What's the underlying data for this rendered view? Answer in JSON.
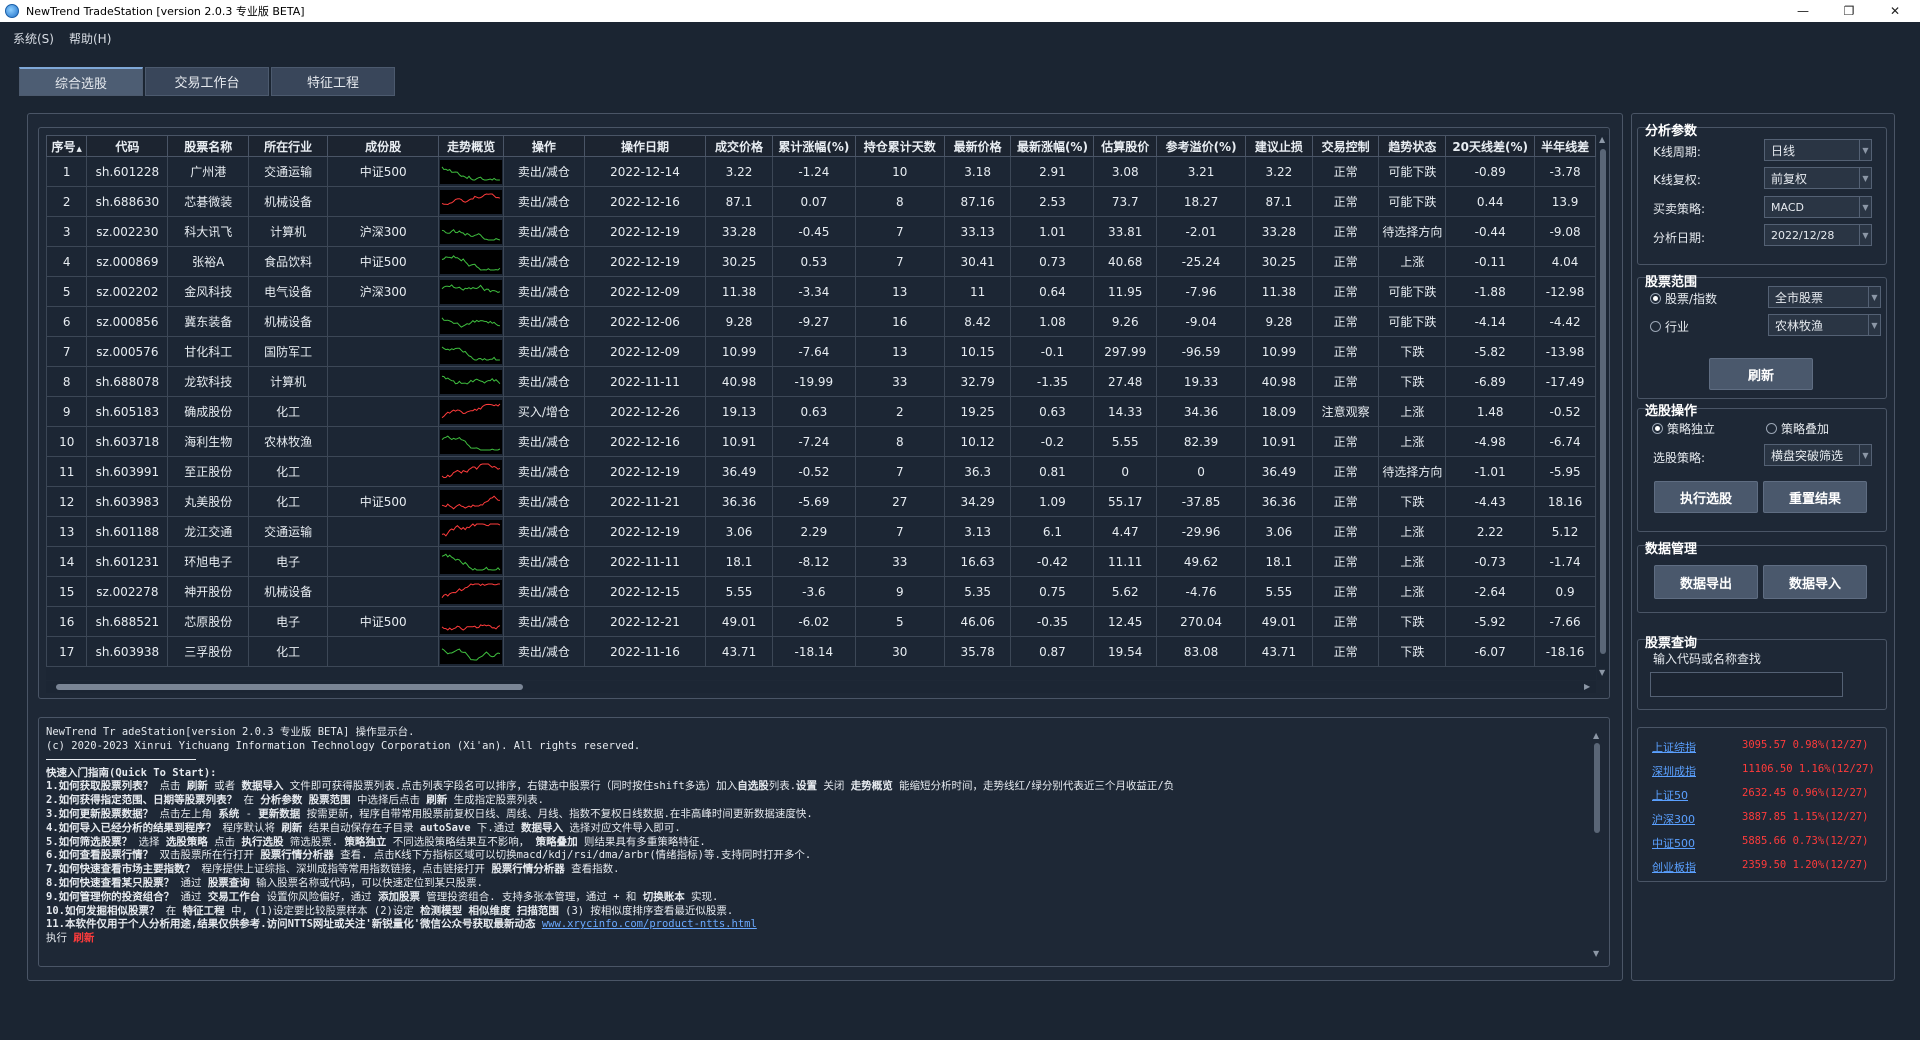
{
  "window": {
    "title": "NewTrend TradeStation [version 2.0.3 专业版 BETA]",
    "min_icon": "—",
    "max_icon": "❐",
    "close_icon": "✕"
  },
  "menu": [
    "系统(S)",
    "帮助(H)"
  ],
  "tabs": [
    {
      "label": "综合选股",
      "active": true
    },
    {
      "label": "交易工作台",
      "active": false
    },
    {
      "label": "特征工程",
      "active": false
    }
  ],
  "table": {
    "columns": [
      "序号",
      "代码",
      "股票名称",
      "所在行业",
      "成份股",
      "走势概览",
      "操作",
      "操作日期",
      "成交价格",
      "累计涨幅(%)",
      "持仓累计天数",
      "最新价格",
      "最新涨幅(%)",
      "估算股价",
      "参考溢价(%)",
      "建议止损",
      "交易控制",
      "趋势状态",
      "20天线差(%)",
      "半年线差"
    ],
    "rows": [
      {
        "n": "1",
        "code": "sh.601228",
        "name": "广州港",
        "ind": "交通运输",
        "comp": "中证500",
        "trend": "down",
        "op": "卖出/减仓",
        "date": "2022-12-14",
        "price": "3.22",
        "cum": "-1.24",
        "days": "10",
        "last": "3.18",
        "chg": "2.91",
        "est": "3.08",
        "prem": "3.21",
        "stop": "3.22",
        "ctrl": "正常",
        "state": "可能下跌",
        "d20": "-0.89",
        "half": "-3.78"
      },
      {
        "n": "2",
        "code": "sh.688630",
        "name": "芯碁微装",
        "ind": "机械设备",
        "comp": "",
        "trend": "up",
        "op": "卖出/减仓",
        "date": "2022-12-16",
        "price": "87.1",
        "cum": "0.07",
        "days": "8",
        "last": "87.16",
        "chg": "2.53",
        "est": "73.7",
        "prem": "18.27",
        "stop": "87.1",
        "ctrl": "正常",
        "state": "可能下跌",
        "d20": "0.44",
        "half": "13.9"
      },
      {
        "n": "3",
        "code": "sz.002230",
        "name": "科大讯飞",
        "ind": "计算机",
        "comp": "沪深300",
        "trend": "down",
        "op": "卖出/减仓",
        "date": "2022-12-19",
        "price": "33.28",
        "cum": "-0.45",
        "days": "7",
        "last": "33.13",
        "chg": "1.01",
        "est": "33.81",
        "prem": "-2.01",
        "stop": "33.28",
        "ctrl": "正常",
        "state": "待选择方向",
        "d20": "-0.44",
        "half": "-9.08"
      },
      {
        "n": "4",
        "code": "sz.000869",
        "name": "张裕A",
        "ind": "食品饮料",
        "comp": "中证500",
        "trend": "down",
        "op": "卖出/减仓",
        "date": "2022-12-19",
        "price": "30.25",
        "cum": "0.53",
        "days": "7",
        "last": "30.41",
        "chg": "0.73",
        "est": "40.68",
        "prem": "-25.24",
        "stop": "30.25",
        "ctrl": "正常",
        "state": "上涨",
        "d20": "-0.11",
        "half": "4.04"
      },
      {
        "n": "5",
        "code": "sz.002202",
        "name": "金风科技",
        "ind": "电气设备",
        "comp": "沪深300",
        "trend": "down",
        "op": "卖出/减仓",
        "date": "2022-12-09",
        "price": "11.38",
        "cum": "-3.34",
        "days": "13",
        "last": "11",
        "chg": "0.64",
        "est": "11.95",
        "prem": "-7.96",
        "stop": "11.38",
        "ctrl": "正常",
        "state": "可能下跌",
        "d20": "-1.88",
        "half": "-12.98"
      },
      {
        "n": "6",
        "code": "sz.000856",
        "name": "冀东装备",
        "ind": "机械设备",
        "comp": "",
        "trend": "down",
        "op": "卖出/减仓",
        "date": "2022-12-06",
        "price": "9.28",
        "cum": "-9.27",
        "days": "16",
        "last": "8.42",
        "chg": "1.08",
        "est": "9.26",
        "prem": "-9.04",
        "stop": "9.28",
        "ctrl": "正常",
        "state": "可能下跌",
        "d20": "-4.14",
        "half": "-4.42"
      },
      {
        "n": "7",
        "code": "sz.000576",
        "name": "甘化科工",
        "ind": "国防军工",
        "comp": "",
        "trend": "down",
        "op": "卖出/减仓",
        "date": "2022-12-09",
        "price": "10.99",
        "cum": "-7.64",
        "days": "13",
        "last": "10.15",
        "chg": "-0.1",
        "est": "297.99",
        "prem": "-96.59",
        "stop": "10.99",
        "ctrl": "正常",
        "state": "下跌",
        "d20": "-5.82",
        "half": "-13.98"
      },
      {
        "n": "8",
        "code": "sh.688078",
        "name": "龙软科技",
        "ind": "计算机",
        "comp": "",
        "trend": "down",
        "op": "卖出/减仓",
        "date": "2022-11-11",
        "price": "40.98",
        "cum": "-19.99",
        "days": "33",
        "last": "32.79",
        "chg": "-1.35",
        "est": "27.48",
        "prem": "19.33",
        "stop": "40.98",
        "ctrl": "正常",
        "state": "下跌",
        "d20": "-6.89",
        "half": "-17.49"
      },
      {
        "n": "9",
        "code": "sh.605183",
        "name": "确成股份",
        "ind": "化工",
        "comp": "",
        "trend": "up",
        "op": "买入/增仓",
        "date": "2022-12-26",
        "price": "19.13",
        "cum": "0.63",
        "days": "2",
        "last": "19.25",
        "chg": "0.63",
        "est": "14.33",
        "prem": "34.36",
        "stop": "18.09",
        "ctrl": "注意观察",
        "state": "上涨",
        "d20": "1.48",
        "half": "-0.52"
      },
      {
        "n": "10",
        "code": "sh.603718",
        "name": "海利生物",
        "ind": "农林牧渔",
        "comp": "",
        "trend": "down",
        "op": "卖出/减仓",
        "date": "2022-12-16",
        "price": "10.91",
        "cum": "-7.24",
        "days": "8",
        "last": "10.12",
        "chg": "-0.2",
        "est": "5.55",
        "prem": "82.39",
        "stop": "10.91",
        "ctrl": "正常",
        "state": "上涨",
        "d20": "-4.98",
        "half": "-6.74"
      },
      {
        "n": "11",
        "code": "sh.603991",
        "name": "至正股份",
        "ind": "化工",
        "comp": "",
        "trend": "up",
        "op": "卖出/减仓",
        "date": "2022-12-19",
        "price": "36.49",
        "cum": "-0.52",
        "days": "7",
        "last": "36.3",
        "chg": "0.81",
        "est": "0",
        "prem": "0",
        "stop": "36.49",
        "ctrl": "正常",
        "state": "待选择方向",
        "d20": "-1.01",
        "half": "-5.95"
      },
      {
        "n": "12",
        "code": "sh.603983",
        "name": "丸美股份",
        "ind": "化工",
        "comp": "中证500",
        "trend": "up",
        "op": "卖出/减仓",
        "date": "2022-11-21",
        "price": "36.36",
        "cum": "-5.69",
        "days": "27",
        "last": "34.29",
        "chg": "1.09",
        "est": "55.17",
        "prem": "-37.85",
        "stop": "36.36",
        "ctrl": "正常",
        "state": "下跌",
        "d20": "-4.43",
        "half": "18.16"
      },
      {
        "n": "13",
        "code": "sh.601188",
        "name": "龙江交通",
        "ind": "交通运输",
        "comp": "",
        "trend": "up",
        "op": "卖出/减仓",
        "date": "2022-12-19",
        "price": "3.06",
        "cum": "2.29",
        "days": "7",
        "last": "3.13",
        "chg": "6.1",
        "est": "4.47",
        "prem": "-29.96",
        "stop": "3.06",
        "ctrl": "正常",
        "state": "上涨",
        "d20": "2.22",
        "half": "5.12"
      },
      {
        "n": "14",
        "code": "sh.601231",
        "name": "环旭电子",
        "ind": "电子",
        "comp": "",
        "trend": "down",
        "op": "卖出/减仓",
        "date": "2022-11-11",
        "price": "18.1",
        "cum": "-8.12",
        "days": "33",
        "last": "16.63",
        "chg": "-0.42",
        "est": "11.11",
        "prem": "49.62",
        "stop": "18.1",
        "ctrl": "正常",
        "state": "上涨",
        "d20": "-0.73",
        "half": "-1.74"
      },
      {
        "n": "15",
        "code": "sz.002278",
        "name": "神开股份",
        "ind": "机械设备",
        "comp": "",
        "trend": "up",
        "op": "卖出/减仓",
        "date": "2022-12-15",
        "price": "5.55",
        "cum": "-3.6",
        "days": "9",
        "last": "5.35",
        "chg": "0.75",
        "est": "5.62",
        "prem": "-4.76",
        "stop": "5.55",
        "ctrl": "正常",
        "state": "上涨",
        "d20": "-2.64",
        "half": "0.9"
      },
      {
        "n": "16",
        "code": "sh.688521",
        "name": "芯原股份",
        "ind": "电子",
        "comp": "中证500",
        "trend": "up",
        "op": "卖出/减仓",
        "date": "2022-12-21",
        "price": "49.01",
        "cum": "-6.02",
        "days": "5",
        "last": "46.06",
        "chg": "-0.35",
        "est": "12.45",
        "prem": "270.04",
        "stop": "49.01",
        "ctrl": "正常",
        "state": "下跌",
        "d20": "-5.92",
        "half": "-7.66"
      },
      {
        "n": "17",
        "code": "sh.603938",
        "name": "三孚股份",
        "ind": "化工",
        "comp": "",
        "trend": "down",
        "op": "卖出/减仓",
        "date": "2022-11-16",
        "price": "43.71",
        "cum": "-18.14",
        "days": "30",
        "last": "35.78",
        "chg": "0.87",
        "est": "19.54",
        "prem": "83.08",
        "stop": "43.71",
        "ctrl": "正常",
        "state": "下跌",
        "d20": "-6.07",
        "half": "-18.16"
      }
    ]
  },
  "log": {
    "lines": [
      [
        {
          "t": "NewTrend Tr adeStation[version 2.0.3 专业版 BETA] 操作显示台."
        }
      ],
      [
        {
          "t": "(c) 2020-2023 Xinrui Yichuang Information Technology Corporation (Xi'an). All rights reserved."
        }
      ],
      [
        {
          "t": ""
        }
      ],
      [
        {
          "t": "快速入门指南(Quick To Start):",
          "b": true
        }
      ],
      [
        {
          "t": "1.如何获取股票列表？",
          "b": true
        },
        {
          "t": " 点击 "
        },
        {
          "t": "刷新",
          "b": true
        },
        {
          "t": " 或者 "
        },
        {
          "t": "数据导入",
          "b": true
        },
        {
          "t": " 文件即可获得股票列表.点击列表字段名可以排序，右键选中股票行（同时按住shift多选）加入"
        },
        {
          "t": "自选股",
          "b": true
        },
        {
          "t": "列表."
        },
        {
          "t": "设置",
          "b": true
        },
        {
          "t": " 关闭 "
        },
        {
          "t": "走势概览",
          "b": true
        },
        {
          "t": " 能缩短分析时间，走势线红/绿分别代表近三个月收益正/负"
        }
      ],
      [
        {
          "t": "2.如何获得指定范围、日期等股票列表？",
          "b": true
        },
        {
          "t": " 在 "
        },
        {
          "t": "分析参数",
          "b": true
        },
        {
          "t": " "
        },
        {
          "t": "股票范围",
          "b": true
        },
        {
          "t": " 中选择后点击 "
        },
        {
          "t": "刷新",
          "b": true
        },
        {
          "t": " 生成指定股票列表."
        }
      ],
      [
        {
          "t": "3.如何更新股票数据？",
          "b": true
        },
        {
          "t": " 点击左上角 "
        },
        {
          "t": "系统",
          "b": true
        },
        {
          "t": " - "
        },
        {
          "t": "更新数据",
          "b": true
        },
        {
          "t": " 按需更新，程序自带常用股票前复权日线、周线、月线、指数不复权日线数据.在非高峰时间更新数据速度快."
        }
      ],
      [
        {
          "t": "4.如何导入已经分析的结果到程序？",
          "b": true
        },
        {
          "t": " 程序默认将 "
        },
        {
          "t": "刷新",
          "b": true
        },
        {
          "t": " 结果自动保存在子目录 "
        },
        {
          "t": "autoSave",
          "b": true
        },
        {
          "t": " 下.通过 "
        },
        {
          "t": "数据导入",
          "b": true
        },
        {
          "t": " 选择对应文件导入即可."
        }
      ],
      [
        {
          "t": "5.如何筛选股票？",
          "b": true
        },
        {
          "t": " 选择 "
        },
        {
          "t": "选股策略",
          "b": true
        },
        {
          "t": " 点击 "
        },
        {
          "t": "执行选股",
          "b": true
        },
        {
          "t": " 筛选股票. "
        },
        {
          "t": "策略独立",
          "b": true
        },
        {
          "t": " 不同选股策略结果互不影响， "
        },
        {
          "t": "策略叠加",
          "b": true
        },
        {
          "t": " 则结果具有多重策略特征."
        }
      ],
      [
        {
          "t": "6.如何查看股票行情？",
          "b": true
        },
        {
          "t": " 双击股票所在行打开 "
        },
        {
          "t": "股票行情分析器",
          "b": true
        },
        {
          "t": " 查看. 点击K线下方指标区域可以切换macd/kdj/rsi/dma/arbr(情绪指标)等.支持同时打开多个."
        }
      ],
      [
        {
          "t": "7.如何快速查看市场主要指数？",
          "b": true
        },
        {
          "t": " 程序提供上证综指、深圳成指等常用指数链接，点击链接打开 "
        },
        {
          "t": "股票行情分析器",
          "b": true
        },
        {
          "t": " 查看指数."
        }
      ],
      [
        {
          "t": "8.如何快速查看某只股票？",
          "b": true
        },
        {
          "t": " 通过 "
        },
        {
          "t": "股票查询",
          "b": true
        },
        {
          "t": " 输入股票名称或代码，可以快速定位到某只股票."
        }
      ],
      [
        {
          "t": "9.如何管理你的投资组合？",
          "b": true
        },
        {
          "t": " 通过 "
        },
        {
          "t": "交易工作台",
          "b": true
        },
        {
          "t": " 设置你风险偏好，通过 "
        },
        {
          "t": "添加股票",
          "b": true
        },
        {
          "t": " 管理投资组合. 支持多张本管理，通过 + 和 "
        },
        {
          "t": "切换账本",
          "b": true
        },
        {
          "t": " 实现."
        }
      ],
      [
        {
          "t": "10.如何发掘相似股票？",
          "b": true
        },
        {
          "t": " 在 "
        },
        {
          "t": "特征工程",
          "b": true
        },
        {
          "t": " 中, (1)设定要比较股票样本 (2)设定 "
        },
        {
          "t": "检测模型",
          "b": true
        },
        {
          "t": " "
        },
        {
          "t": "相似维度",
          "b": true
        },
        {
          "t": " "
        },
        {
          "t": "扫描范围",
          "b": true
        },
        {
          "t": " (3) 按相似度排序查看最近似股票."
        }
      ],
      [
        {
          "t": "11.本软件仅用于个人分析用途,结果仅供参考.访问NTTS网址或关注'新锐量化'微信公众号获取最新动态 ",
          "b": true
        },
        {
          "t": "www.xrycinfo.com/product-ntts.html",
          "link": true
        }
      ],
      [
        {
          "t": "执行 "
        },
        {
          "t": "刷新",
          "red": true
        }
      ]
    ]
  },
  "params": {
    "title": "分析参数",
    "kline_period": {
      "label": "K线周期:",
      "value": "日线"
    },
    "kline_adjust": {
      "label": "K线复权:",
      "value": "前复权"
    },
    "strategy": {
      "label": "买卖策略:",
      "value": "MACD"
    },
    "date": {
      "label": "分析日期:",
      "value": "2022/12/28"
    }
  },
  "scope": {
    "title": "股票范围",
    "opt1": {
      "label": "股票/指数",
      "value": "全市股票",
      "checked": true
    },
    "opt2": {
      "label": "行业",
      "value": "农林牧渔",
      "checked": false
    },
    "refresh": "刷新"
  },
  "selection": {
    "title": "选股操作",
    "independent": "策略独立",
    "overlay": "策略叠加",
    "strategy": {
      "label": "选股策略:",
      "value": "横盘突破筛选"
    },
    "run": "执行选股",
    "reset": "重置结果"
  },
  "datamgmt": {
    "title": "数据管理",
    "export": "数据导出",
    "import": "数据导入"
  },
  "query": {
    "title": "股票查询",
    "hint": "输入代码或名称查找",
    "value": ""
  },
  "indices": [
    {
      "name": "上证综指",
      "value": "3095.57 0.98%(12/27)"
    },
    {
      "name": "深圳成指",
      "value": "11106.50 1.16%(12/27)"
    },
    {
      "name": "上证50",
      "value": "2632.45 0.96%(12/27)"
    },
    {
      "name": "沪深300",
      "value": "3887.85 1.15%(12/27)"
    },
    {
      "name": "中证500",
      "value": "5885.66 0.73%(12/27)"
    },
    {
      "name": "创业板指",
      "value": "2359.50 1.20%(12/27)"
    }
  ],
  "colors": {
    "up": "#ff3b3b",
    "down": "#3fbf3f",
    "bg": "#1b2532"
  }
}
